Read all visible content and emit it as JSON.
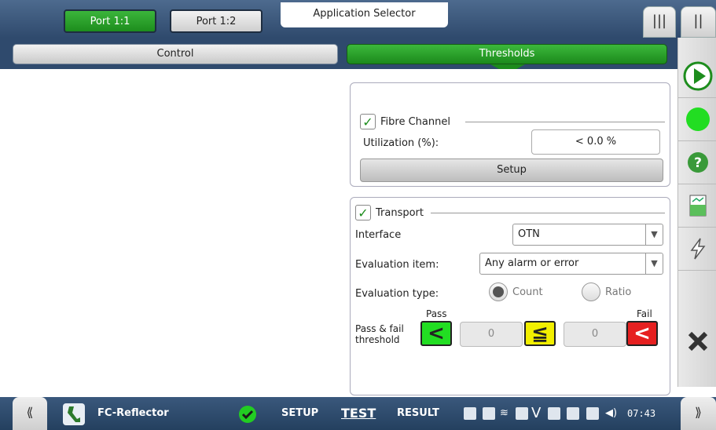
{
  "header": {
    "port_tabs": [
      {
        "label": "Port 1:1",
        "active": true
      },
      {
        "label": "Port 1:2",
        "active": false
      }
    ],
    "app_selector": "Application Selector"
  },
  "tabs": {
    "control": "Control",
    "thresholds": "Thresholds"
  },
  "fibre_channel": {
    "title": "Fibre Channel",
    "checked": true,
    "utilization_label": "Utilization (%):",
    "utilization_value": "< 0.0 %",
    "setup_label": "Setup"
  },
  "transport": {
    "title": "Transport",
    "checked": true,
    "interface_label": "Interface",
    "interface_value": "OTN",
    "evaluation_item_label": "Evaluation item:",
    "evaluation_item_value": "Any alarm or error",
    "evaluation_type_label": "Evaluation type:",
    "evaluation_type_options": [
      "Count",
      "Ratio"
    ],
    "evaluation_type_selected": "Count",
    "pass_label": "Pass",
    "fail_label": "Fail",
    "threshold_label_line1": "Pass & fail",
    "threshold_label_line2": "threshold",
    "pass_value": "0",
    "fail_value": "0"
  },
  "bottom": {
    "app_name": "FC-Reflector",
    "setup": "SETUP",
    "test": "TEST",
    "result": "RESULT",
    "time": "07:43"
  },
  "colors": {
    "accent_green": "#1d8d1d",
    "pass_green": "#22dd22",
    "warn_yellow": "#f2ef00",
    "fail_red": "#e62020",
    "nav_blue": "#2f4a6d"
  }
}
